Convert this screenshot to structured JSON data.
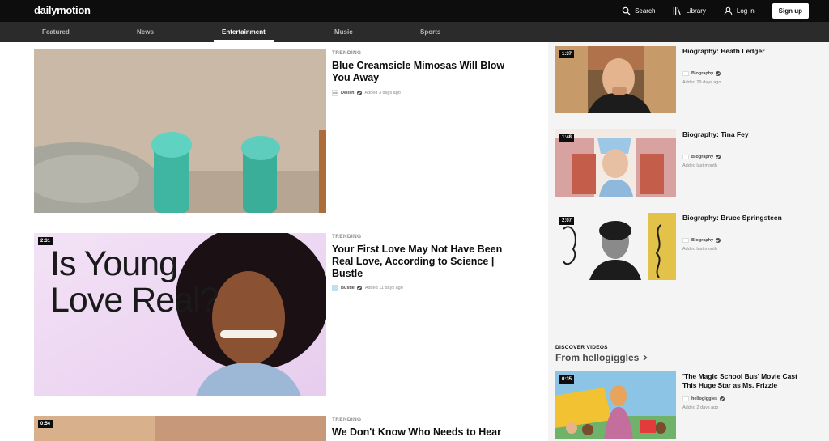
{
  "header": {
    "logo": "dailymotion",
    "search_label": "Search",
    "library_label": "Library",
    "login_label": "Log in",
    "signup_label": "Sign up"
  },
  "nav": {
    "tabs": [
      {
        "label": "Featured"
      },
      {
        "label": "News"
      },
      {
        "label": "Entertainment",
        "active": true
      },
      {
        "label": "Music"
      },
      {
        "label": "Sports"
      }
    ]
  },
  "main_videos": [
    {
      "label": "TRENDING",
      "title": "Blue Creamsicle Mimosas Will Blow You Away",
      "channel": "Delish",
      "channel_logo": "ddd",
      "added": "Added 3 days ago"
    },
    {
      "label": "TRENDING",
      "duration": "2:31",
      "title": "Your First Love May Not Have Been Real Love, According to Science | Bustle",
      "thumb_text": "Is Young Love Real?",
      "channel": "Bustle",
      "added": "Added 11 days ago"
    },
    {
      "label": "TRENDING",
      "duration": "0:54",
      "title": "We Don't Know Who Needs to Hear"
    }
  ],
  "side_videos": [
    {
      "duration": "1:37",
      "title": "Biography: Heath Ledger",
      "channel": "Biography",
      "added": "Added 29 days ago"
    },
    {
      "duration": "1:48",
      "title": "Biography: Tina Fey",
      "channel": "Biography",
      "added": "Added last month"
    },
    {
      "duration": "2:07",
      "title": "Biography: Bruce Springsteen",
      "channel": "Biography",
      "added": "Added last month"
    }
  ],
  "discover": {
    "label": "DISCOVER VIDEOS",
    "title": "From hellogiggles",
    "video": {
      "duration": "0:35",
      "title": "'The Magic School Bus' Movie Cast This Huge Star as Ms. Frizzle",
      "channel": "hellogiggles",
      "added": "Added 2 days ago"
    }
  },
  "colors": {
    "topbar": "#0d0d0d",
    "navbar": "#2b2b2b",
    "sidebar": "#f4f4f4"
  }
}
